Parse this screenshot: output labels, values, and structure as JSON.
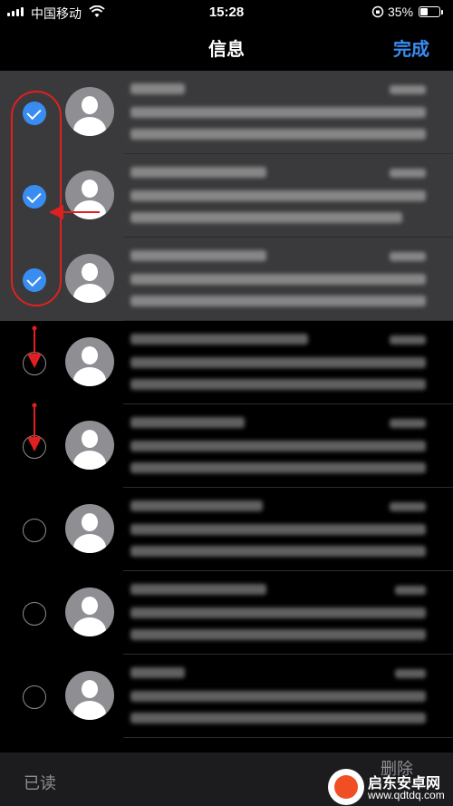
{
  "status_bar": {
    "carrier": "中国移动",
    "time": "15:28",
    "battery_percent": "35%",
    "battery_level": 0.35
  },
  "nav": {
    "title": "信息",
    "done_label": "完成"
  },
  "messages": [
    {
      "selected": true
    },
    {
      "selected": true
    },
    {
      "selected": true
    },
    {
      "selected": false
    },
    {
      "selected": false
    },
    {
      "selected": false
    },
    {
      "selected": false
    },
    {
      "selected": false
    }
  ],
  "toolbar": {
    "read_label": "已读",
    "delete_label": "删除"
  },
  "watermark": {
    "name": "启东安卓网",
    "url": "www.qdtdq.com"
  },
  "colors": {
    "accent": "#3a8df0",
    "annotation": "#e02020",
    "selected_row": "#3a3a3c"
  },
  "icons": [
    "signal-icon",
    "wifi-icon",
    "orientation-lock-icon",
    "battery-icon",
    "checkmark-icon",
    "avatar-icon"
  ]
}
